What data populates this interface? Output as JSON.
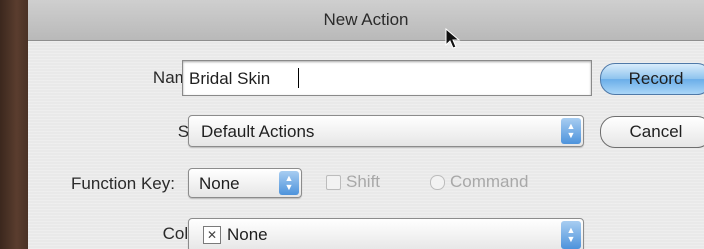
{
  "window": {
    "title": "New Action"
  },
  "form": {
    "name_label": "Name:",
    "name_value": "Bridal Skin",
    "set_label": "Set:",
    "set_value": "Default Actions",
    "function_key_label": "Function Key:",
    "function_key_value": "None",
    "shift_label": "Shift",
    "command_label": "Command",
    "shift_checked": false,
    "command_checked": false,
    "color_label": "Color:",
    "color_swatch": "✕",
    "color_value": "None"
  },
  "buttons": {
    "record": "Record",
    "cancel": "Cancel"
  },
  "icons": {
    "popup_arrows": "up-down-arrows",
    "cursor": "arrow-cursor"
  },
  "colors": {
    "default_button": "#8ec3ee",
    "popup_arrow": "#4d93dc"
  }
}
